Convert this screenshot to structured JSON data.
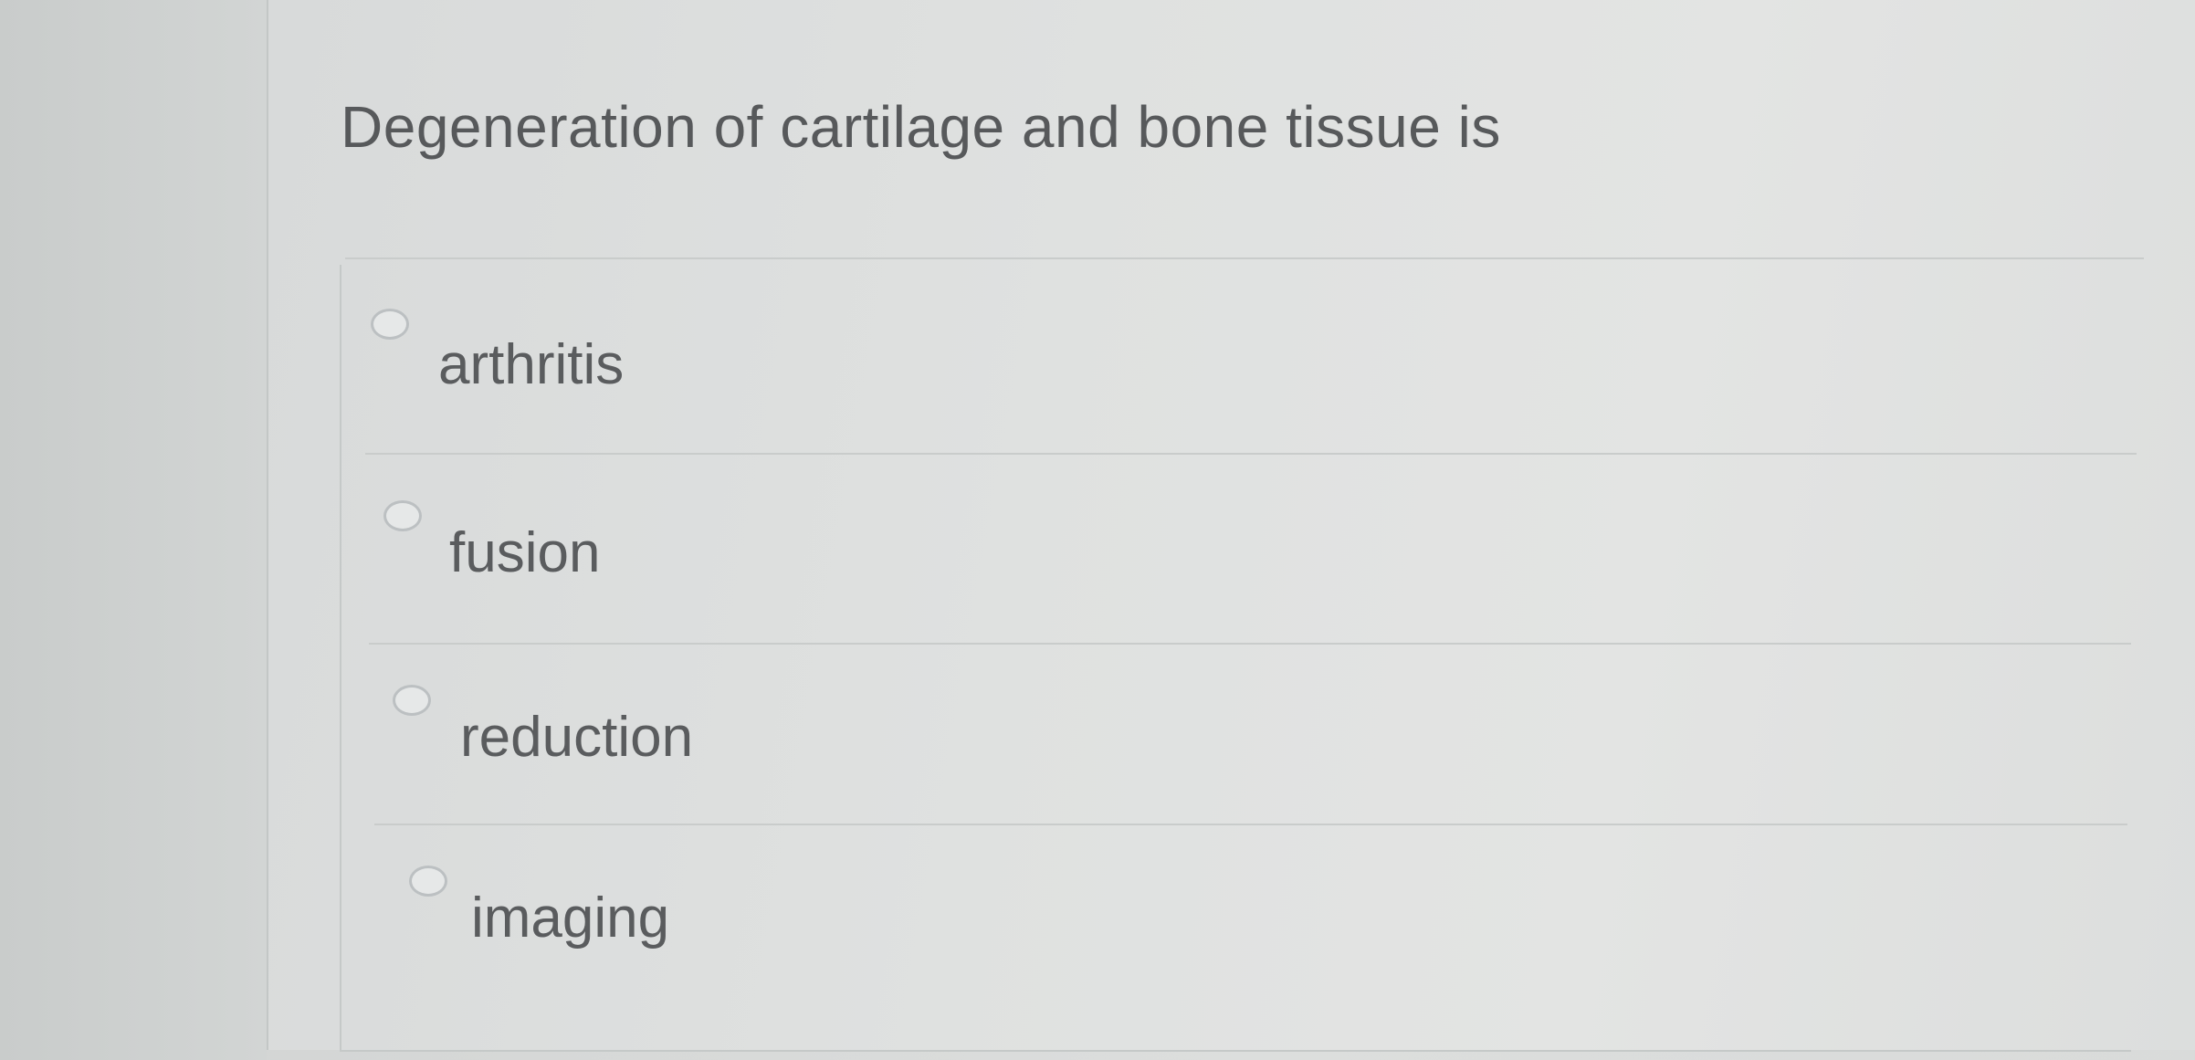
{
  "question": {
    "text": "Degeneration of cartilage and bone tissue is"
  },
  "options": [
    {
      "label": "arthritis",
      "selected": false
    },
    {
      "label": "fusion",
      "selected": false
    },
    {
      "label": "reduction",
      "selected": false
    },
    {
      "label": "imaging",
      "selected": false
    }
  ]
}
